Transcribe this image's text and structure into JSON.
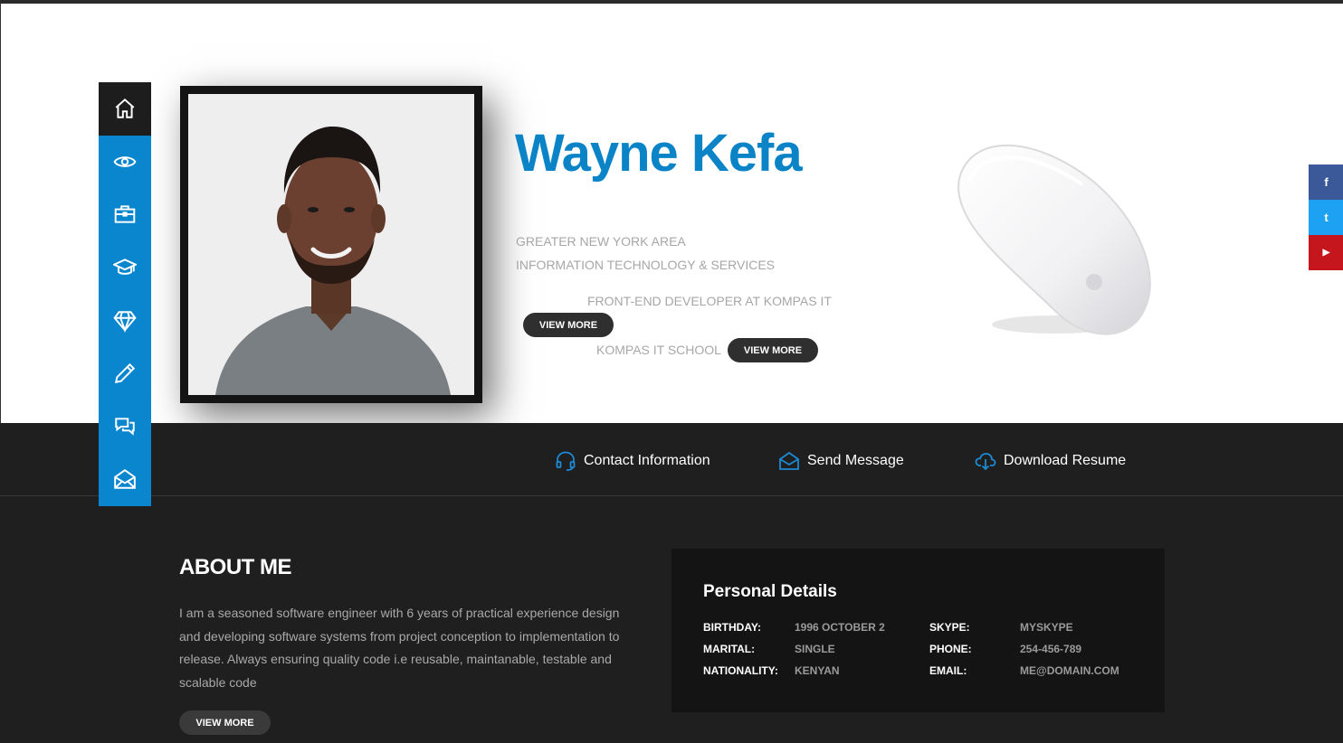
{
  "profile": {
    "name": "Wayne Kefa",
    "location": "GREATER NEW YORK AREA",
    "industry": "INFORMATION TECHNOLOGY & SERVICES",
    "job": "FRONT-END DEVELOPER AT KOMPAS IT",
    "school": "KOMPAS IT SCHOOL",
    "view_more_1": "VIEW MORE",
    "view_more_2": "VIEW MORE"
  },
  "sidebar": {
    "items": [
      {
        "icon": "home-icon"
      },
      {
        "icon": "eye-icon"
      },
      {
        "icon": "briefcase-icon"
      },
      {
        "icon": "graduation-cap-icon"
      },
      {
        "icon": "diamond-icon"
      },
      {
        "icon": "pencil-icon"
      },
      {
        "icon": "chat-icon"
      },
      {
        "icon": "envelope-icon"
      }
    ]
  },
  "social": {
    "facebook": "f",
    "twitter": "t",
    "youtube": "▶",
    "colors": {
      "facebook": "#3b5998",
      "twitter": "#1da1f2",
      "youtube": "#c4161c"
    }
  },
  "actions": {
    "contact": "Contact Information",
    "message": "Send Message",
    "resume": "Download Resume"
  },
  "about": {
    "title": "ABOUT ME",
    "text": "I am a seasoned software engineer with 6 years of practical experience design and developing software systems from project conception to implementation to release. Always ensuring quality code i.e reusable, maintanable, testable and scalable code",
    "button": "VIEW MORE"
  },
  "details": {
    "title": "Personal Details",
    "left": [
      {
        "key": "BIRTHDAY:",
        "value": "1996 OCTOBER 2"
      },
      {
        "key": "MARITAL:",
        "value": "SINGLE"
      },
      {
        "key": "NATIONALITY:",
        "value": "KENYAN"
      }
    ],
    "right": [
      {
        "key": "SKYPE:",
        "value": "MYSKYPE"
      },
      {
        "key": "PHONE:",
        "value": "254-456-789"
      },
      {
        "key": "EMAIL:",
        "value": "ME@DOMAIN.COM"
      }
    ]
  },
  "colors": {
    "accent": "#0a84c6",
    "dark": "#1f1f20"
  }
}
